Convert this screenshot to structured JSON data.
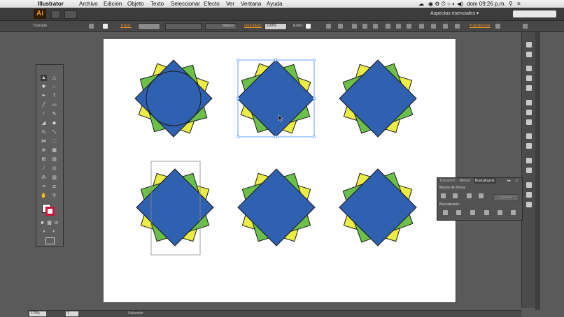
{
  "menubar": {
    "apple": "",
    "app": "Illustrator",
    "items": [
      "Archivo",
      "Edición",
      "Objeto",
      "Texto",
      "Seleccionar",
      "Efecto",
      "Ver",
      "Ventana",
      "Ayuda"
    ],
    "clock": "dom 09:26 p.m."
  },
  "appbar": {
    "logo": "Ai",
    "workspace": "Aspectos esenciales ▾"
  },
  "controlbar": {
    "label": "Trazado",
    "stroke_label": "Trazo:",
    "brush_label": "Básico",
    "opacity_label": "Opacidad:",
    "opacity_value": "100%",
    "style_label": "Estilo:",
    "transform_label": "Transformar"
  },
  "pathfinder": {
    "tabs": [
      "Transform",
      "Alinear",
      "Buscatrazos"
    ],
    "active_tab": "Buscatrazos",
    "shape_modes_label": "Modos de forma:",
    "pathfinders_label": "Buscatrazos:",
    "expand_label": "Expandir"
  },
  "statusbar": {
    "zoom": "175%",
    "page": "1",
    "tool": "Selección"
  },
  "colors": {
    "blue": "#3060b0",
    "green": "#6cc04a",
    "yellow": "#ecec46",
    "accent_orange": "#f29424"
  }
}
